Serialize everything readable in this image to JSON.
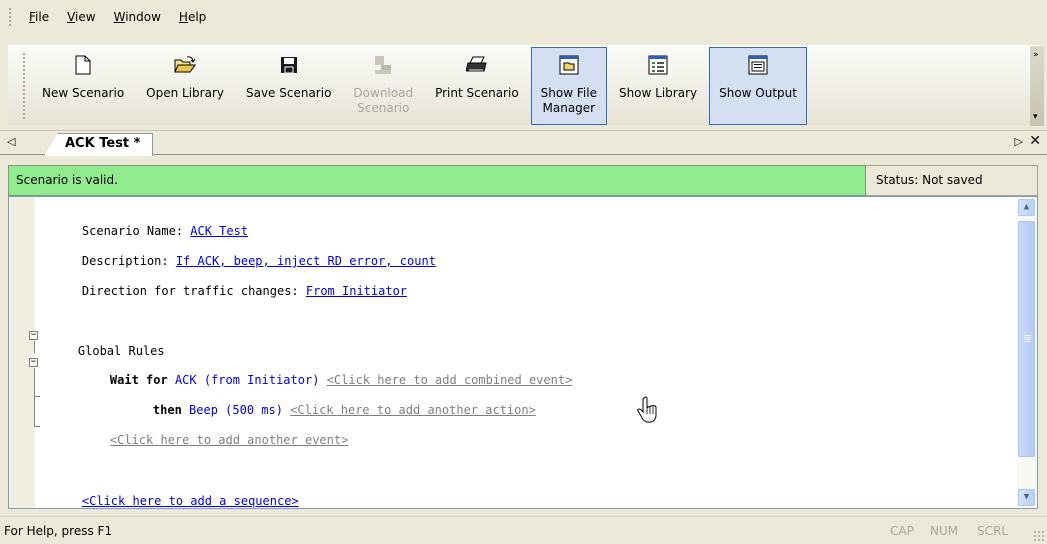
{
  "menu": [
    {
      "label": "File",
      "accel": "F",
      "rest": "ile"
    },
    {
      "label": "View",
      "accel": "V",
      "rest": "iew"
    },
    {
      "label": "Window",
      "accel": "W",
      "rest": "indow"
    },
    {
      "label": "Help",
      "accel": "H",
      "rest": "elp"
    }
  ],
  "toolbar": {
    "new_scenario": "New Scenario",
    "open_library": "Open Library",
    "save_scenario": "Save Scenario",
    "download_scenario_1": "Download",
    "download_scenario_2": "Scenario",
    "print_scenario": "Print Scenario",
    "show_file_manager_1": "Show File",
    "show_file_manager_2": "Manager",
    "show_library": "Show Library",
    "show_output": "Show Output"
  },
  "tab": {
    "title": "ACK Test *"
  },
  "status_band": {
    "valid": "Scenario is valid.",
    "save_status": "Status: Not saved"
  },
  "editor": {
    "name_label": "Scenario Name: ",
    "name_value": "ACK Test",
    "desc_label": "Description: ",
    "desc_value": "If ACK, beep, inject RD error, count",
    "dir_label": "Direction for traffic changes: ",
    "dir_value": "From Initiator",
    "global_rules": "Global Rules",
    "wait_for": "Wait for ",
    "event": "ACK (from Initiator)",
    "add_combined": "<Click here to add combined event>",
    "then": "then ",
    "action": "Beep (500 ms)",
    "add_action": "<Click here to add another action>",
    "add_event": "<Click here to add another event>",
    "add_sequence": "<Click here to add a sequence>"
  },
  "statusbar": {
    "help": "For Help, press F1",
    "cap": "CAP",
    "num": "NUM",
    "scrl": "SCRL"
  },
  "colors": {
    "valid_bg": "#90ec8f",
    "link": "#0000ee",
    "hint": "#808080",
    "pressed_bg": "#d4dff2"
  }
}
